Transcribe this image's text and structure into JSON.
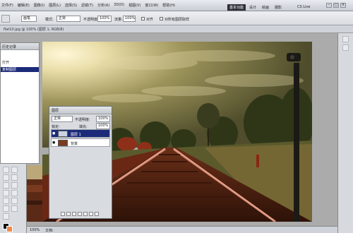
{
  "app": {
    "menu": [
      "文件(F)",
      "编辑(E)",
      "图像(I)",
      "图层(L)",
      "选择(S)",
      "滤镜(T)",
      "分析(A)",
      "3D(D)",
      "视图(V)",
      "窗口(W)",
      "帮助(H)"
    ],
    "zoom": "100%",
    "workspaces": [
      "基本功能",
      "设计",
      "绘画",
      "摄影"
    ],
    "live": "CS Live"
  },
  "options": {
    "mode_label": "模式:",
    "mode_value": "正常",
    "opacity_label": "不透明度:",
    "opacity_value": "100%",
    "flow_label": "流量:",
    "flow_value": "100%",
    "sample_label": "对所有图层取样",
    "aligned_label": "对齐",
    "preset": "画笔"
  },
  "document": {
    "tab_title": "flat10.jpg @ 100% (图层 1, RGB/8)"
  },
  "history": {
    "title": "历史记录",
    "items": [
      "打开",
      "复制图层"
    ]
  },
  "layers": {
    "title": "图层",
    "blend": "正常",
    "opacity_label": "不透明度:",
    "opacity": "100%",
    "lock_label": "锁定:",
    "fill_label": "填充:",
    "fill": "100%",
    "rows": [
      {
        "name": "图层 1",
        "selected": true
      },
      {
        "name": "背景",
        "selected": false
      }
    ]
  },
  "status": {
    "zoom": "100%",
    "doc": "文档:"
  },
  "colors": {
    "selection": "#1c2a7a",
    "workspace_active": "#2c2f35"
  }
}
